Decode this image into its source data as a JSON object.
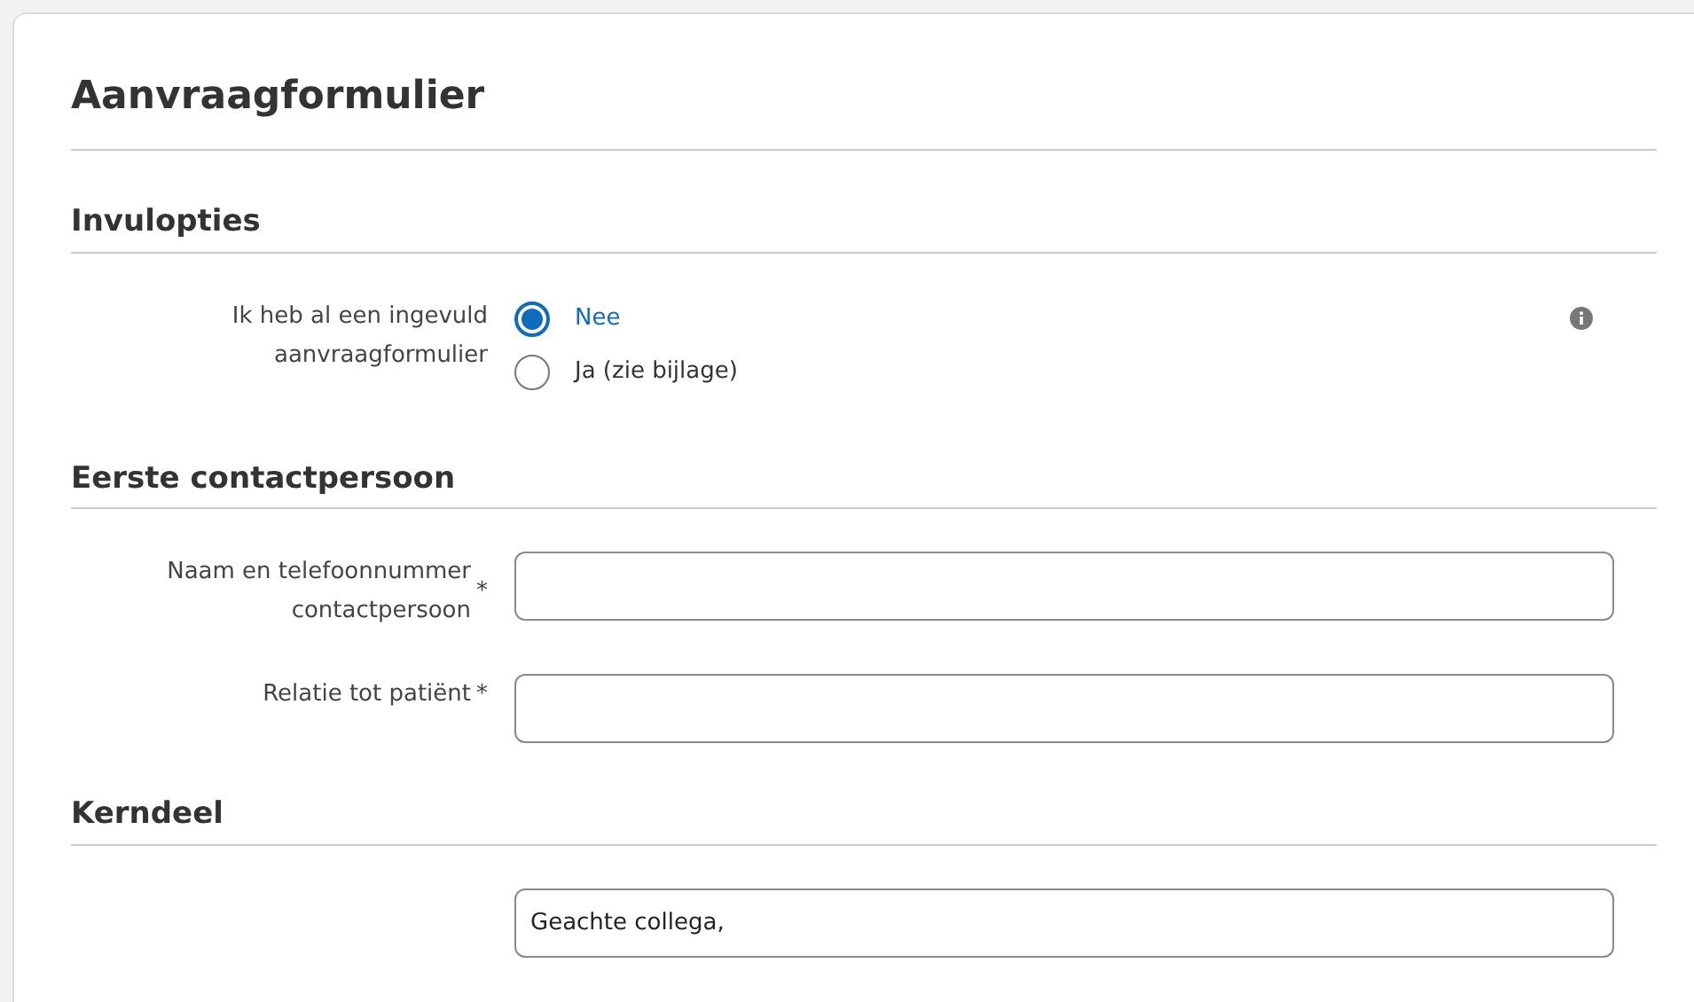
{
  "title": "Aanvraagformulier",
  "sections": [
    {
      "heading": "Invulopties",
      "rows": [
        {
          "kind": "radio",
          "label": "Ik heb al een ingevuld aanvraagformulier",
          "info": true,
          "options": [
            {
              "label": "Nee",
              "selected": true
            },
            {
              "label": "Ja (zie bijlage)",
              "selected": false
            }
          ]
        }
      ]
    },
    {
      "heading": "Eerste contactpersoon",
      "rows": [
        {
          "kind": "text",
          "label": "Naam en telefoonnummer contactpersoon",
          "required_mark": "*"
        },
        {
          "kind": "text",
          "label": "Relatie tot patiënt",
          "required_mark": "*"
        }
      ]
    },
    {
      "heading": "Kerndeel",
      "rows": [
        {
          "kind": "text",
          "value": "Geachte collega,"
        }
      ]
    }
  ]
}
